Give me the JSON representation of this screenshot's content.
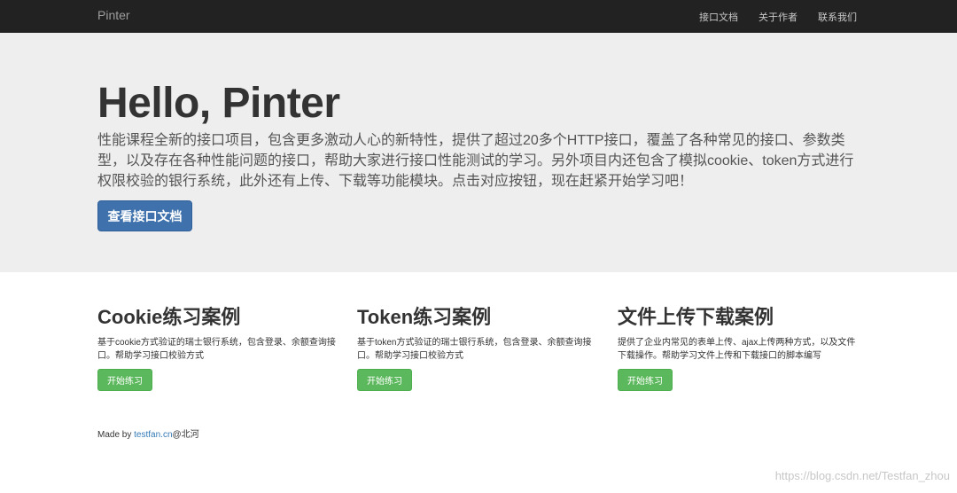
{
  "navbar": {
    "brand": "Pinter",
    "links": [
      "接口文档",
      "关于作者",
      "联系我们"
    ]
  },
  "hero": {
    "title": "Hello, Pinter",
    "description": "性能课程全新的接口项目，包含更多激动人心的新特性，提供了超过20多个HTTP接口，覆盖了各种常见的接口、参数类型，以及存在各种性能问题的接口，帮助大家进行接口性能测试的学习。另外项目内还包含了模拟cookie、token方式进行权限校验的银行系统，此外还有上传、下载等功能模块。点击对应按钮，现在赶紧开始学习吧！",
    "button": "查看接口文档"
  },
  "cards": [
    {
      "title": "Cookie练习案例",
      "desc": "基于cookie方式验证的瑞士银行系统，包含登录、余额查询接口。帮助学习接口校验方式",
      "button": "开始练习"
    },
    {
      "title": "Token练习案例",
      "desc": "基于token方式验证的瑞士银行系统，包含登录、余额查询接口。帮助学习接口校验方式",
      "button": "开始练习"
    },
    {
      "title": "文件上传下载案例",
      "desc": "提供了企业内常见的表单上传、ajax上传两种方式，以及文件下载操作。帮助学习文件上传和下载接口的脚本编写",
      "button": "开始练习"
    }
  ],
  "footer": {
    "prefix": "Made by ",
    "link": "testfan.cn",
    "suffix": "@北河"
  },
  "watermark": "https://blog.csdn.net/Testfan_zhou",
  "colors": {
    "navbar": "#222222",
    "jumbotron": "#eeeeee",
    "primary": "#3f72ad",
    "success": "#5cb85c",
    "link": "#337ab7"
  }
}
